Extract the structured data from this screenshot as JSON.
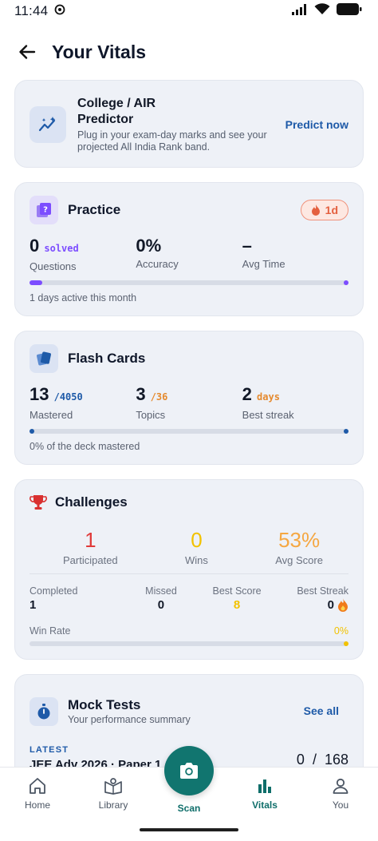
{
  "status_bar": {
    "time": "11:44"
  },
  "header": {
    "title": "Your Vitals"
  },
  "predictor": {
    "title": "College / AIR Predictor",
    "description": "Plug in your exam-day marks and see your projected All India Rank band.",
    "cta": "Predict now"
  },
  "practice": {
    "title": "Practice",
    "streak": "1d",
    "stats": [
      {
        "value": "0",
        "unit": "solved",
        "label": "Questions"
      },
      {
        "value": "0%",
        "unit": "",
        "label": "Accuracy"
      },
      {
        "value": "–",
        "unit": "",
        "label": "Avg Time"
      }
    ],
    "progress": 0.04,
    "note": "1 days active this month"
  },
  "flash_cards": {
    "title": "Flash Cards",
    "stats": [
      {
        "value": "13",
        "unit": "/4050",
        "label": "Mastered"
      },
      {
        "value": "3",
        "unit": "/36",
        "label": "Topics"
      },
      {
        "value": "2",
        "unit": "days",
        "label": "Best streak"
      }
    ],
    "progress": 0.0,
    "note": "0% of the deck mastered"
  },
  "challenges": {
    "title": "Challenges",
    "top": [
      {
        "value": "1",
        "label": "Participated",
        "color": "#e03a3a"
      },
      {
        "value": "0",
        "label": "Wins",
        "color": "#f2c200"
      },
      {
        "value": "53%",
        "label": "Avg Score",
        "color": "#f5a742"
      }
    ],
    "details": [
      {
        "label": "Completed",
        "value": "1"
      },
      {
        "label": "Missed",
        "value": "0"
      },
      {
        "label": "Best Score",
        "value": "8"
      },
      {
        "label": "Best Streak",
        "value": "0"
      }
    ],
    "win_rate_label": "Win Rate",
    "win_rate_value": "0%",
    "win_rate": 0.0
  },
  "mock_tests": {
    "title": "Mock Tests",
    "subtitle": "Your performance summary",
    "cta": "See all",
    "latest_label": "LATEST",
    "latest_name": "JEE Adv 2026 · Paper 1",
    "latest_score": "0",
    "latest_separator": "/",
    "latest_total": "168"
  },
  "nav": {
    "home": "Home",
    "library": "Library",
    "scan": "Scan",
    "vitals": "Vitals",
    "you": "You"
  },
  "colors": {
    "accent_teal": "#11756f",
    "link_blue": "#1e5aa8",
    "practice_purple": "#7c4dff",
    "flash_blue": "#1e5aa8",
    "streak_orange": "#e4603f"
  }
}
